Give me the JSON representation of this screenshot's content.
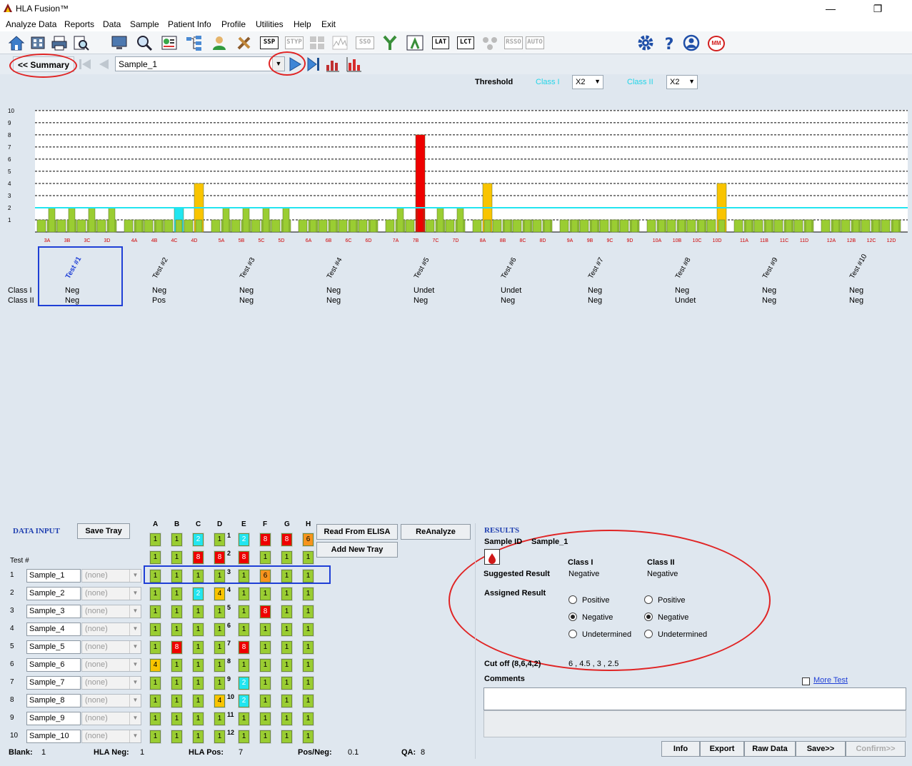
{
  "window": {
    "title": "HLA Fusion™"
  },
  "menu": [
    "Analyze Data",
    "Reports",
    "Data",
    "Sample",
    "Patient Info",
    "Profile",
    "Utilities",
    "Help",
    "Exit"
  ],
  "toolbar": {
    "text_icons": [
      "SSP",
      "STYP",
      "SSO",
      "LAT",
      "LCT",
      "RSSO",
      "AUTO"
    ],
    "right_icons": [
      "gear-icon",
      "help-icon",
      "user-icon",
      "mm-icon"
    ],
    "mm_label": "MM"
  },
  "nav": {
    "summary_label": "<< Summary",
    "sample": "Sample_1"
  },
  "threshold": {
    "label": "Threshold",
    "class1_label": "Class I",
    "class1_value": "X2",
    "class2_label": "Class II",
    "class2_value": "X2"
  },
  "chart_data": {
    "type": "bar",
    "ylim": [
      0,
      10
    ],
    "yticks": [
      1,
      2,
      3,
      4,
      5,
      6,
      7,
      8,
      9,
      10
    ],
    "threshold_line": 2,
    "categories": [
      "3A",
      "3B",
      "3C",
      "3D",
      "4A",
      "4B",
      "4C",
      "4D",
      "5A",
      "5B",
      "5C",
      "5D",
      "6A",
      "6B",
      "6C",
      "6D",
      "7A",
      "7B",
      "7C",
      "7D",
      "8A",
      "8B",
      "8C",
      "8D",
      "9A",
      "9B",
      "9C",
      "9D",
      "10A",
      "10B",
      "10C",
      "10D",
      "11A",
      "11B",
      "11C",
      "11D",
      "12A",
      "12B",
      "12C",
      "12D"
    ],
    "group_pairs": [
      [
        [
          1,
          2
        ],
        [
          1,
          2
        ],
        [
          1,
          2
        ],
        [
          1,
          2
        ]
      ],
      [
        [
          1,
          1
        ],
        [
          1,
          1
        ],
        [
          2,
          1
        ],
        [
          4,
          1
        ]
      ],
      [
        [
          1,
          2
        ],
        [
          1,
          2
        ],
        [
          1,
          2
        ],
        [
          1,
          2
        ]
      ],
      [
        [
          1,
          1
        ],
        [
          1,
          1
        ],
        [
          1,
          1
        ],
        [
          1,
          1
        ]
      ],
      [
        [
          1,
          2
        ],
        [
          8,
          2
        ],
        [
          1,
          2
        ],
        [
          1,
          2
        ]
      ],
      [
        [
          4,
          1
        ],
        [
          1,
          1
        ],
        [
          1,
          1
        ],
        [
          1,
          1
        ]
      ],
      [
        [
          1,
          1
        ],
        [
          1,
          1
        ],
        [
          1,
          1
        ],
        [
          1,
          1
        ]
      ],
      [
        [
          1,
          1
        ],
        [
          1,
          1
        ],
        [
          1,
          1
        ],
        [
          4,
          1
        ]
      ],
      [
        [
          1,
          1
        ],
        [
          1,
          1
        ],
        [
          1,
          1
        ],
        [
          1,
          1
        ]
      ],
      [
        [
          1,
          1
        ],
        [
          1,
          1
        ],
        [
          1,
          1
        ],
        [
          1,
          1
        ]
      ]
    ]
  },
  "tests": [
    {
      "name": "Test #1",
      "class1": "Neg",
      "class2": "Neg"
    },
    {
      "name": "Test #2",
      "class1": "Neg",
      "class2": "Pos"
    },
    {
      "name": "Test #3",
      "class1": "Neg",
      "class2": "Neg"
    },
    {
      "name": "Test #4",
      "class1": "Neg",
      "class2": "Neg"
    },
    {
      "name": "Test #5",
      "class1": "Undet",
      "class2": "Neg"
    },
    {
      "name": "Test #6",
      "class1": "Undet",
      "class2": "Neg"
    },
    {
      "name": "Test #7",
      "class1": "Neg",
      "class2": "Neg"
    },
    {
      "name": "Test #8",
      "class1": "Neg",
      "class2": "Undet"
    },
    {
      "name": "Test #9",
      "class1": "Neg",
      "class2": "Neg"
    },
    {
      "name": "Test #10",
      "class1": "Neg",
      "class2": "Neg"
    }
  ],
  "row_labels": {
    "class1": "Class I",
    "class2": "Class II"
  },
  "data_input": {
    "title": "DATA INPUT",
    "save_tray": "Save Tray",
    "read_elisa": "Read From ELISA",
    "reanalyze": "ReAnalyze",
    "add_tray": "Add New Tray",
    "test_hash": "Test #",
    "columns": [
      "A",
      "B",
      "C",
      "D",
      "E",
      "F",
      "G",
      "H"
    ],
    "control_rows": [
      [
        "1",
        "1",
        "2",
        "1",
        "2",
        "8",
        "8",
        "6"
      ],
      [
        "1",
        "1",
        "8",
        "8",
        "8",
        "1",
        "1",
        "1"
      ]
    ],
    "samples": [
      {
        "no": "1",
        "name": "Sample_1",
        "combo": "(none)",
        "cells": [
          "1",
          "1",
          "1",
          "1",
          "1",
          "6",
          "1",
          "1"
        ],
        "side": "3"
      },
      {
        "no": "2",
        "name": "Sample_2",
        "combo": "(none)",
        "cells": [
          "1",
          "1",
          "2",
          "4",
          "1",
          "1",
          "1",
          "1"
        ],
        "side": "4"
      },
      {
        "no": "3",
        "name": "Sample_3",
        "combo": "(none)",
        "cells": [
          "1",
          "1",
          "1",
          "1",
          "1",
          "8",
          "1",
          "1"
        ],
        "side": "5"
      },
      {
        "no": "4",
        "name": "Sample_4",
        "combo": "(none)",
        "cells": [
          "1",
          "1",
          "1",
          "1",
          "1",
          "1",
          "1",
          "1"
        ],
        "side": "6"
      },
      {
        "no": "5",
        "name": "Sample_5",
        "combo": "(none)",
        "cells": [
          "1",
          "8",
          "1",
          "1",
          "8",
          "1",
          "1",
          "1"
        ],
        "side": "7"
      },
      {
        "no": "6",
        "name": "Sample_6",
        "combo": "(none)",
        "cells": [
          "4",
          "1",
          "1",
          "1",
          "1",
          "1",
          "1",
          "1"
        ],
        "side": "8"
      },
      {
        "no": "7",
        "name": "Sample_7",
        "combo": "(none)",
        "cells": [
          "1",
          "1",
          "1",
          "1",
          "2",
          "1",
          "1",
          "1"
        ],
        "side": "9"
      },
      {
        "no": "8",
        "name": "Sample_8",
        "combo": "(none)",
        "cells": [
          "1",
          "1",
          "1",
          "4",
          "2",
          "1",
          "1",
          "1"
        ],
        "side": "10"
      },
      {
        "no": "9",
        "name": "Sample_9",
        "combo": "(none)",
        "cells": [
          "1",
          "1",
          "1",
          "1",
          "1",
          "1",
          "1",
          "1"
        ],
        "side": "11"
      },
      {
        "no": "10",
        "name": "Sample_10",
        "combo": "(none)",
        "cells": [
          "1",
          "1",
          "1",
          "1",
          "1",
          "1",
          "1",
          "1"
        ],
        "side": "12"
      }
    ],
    "control_side": [
      "1",
      "2"
    ],
    "footer": {
      "blank_label": "Blank:",
      "blank": "1",
      "hlaneg_label": "HLA Neg:",
      "hlaneg": "1",
      "hlapos_label": "HLA Pos:",
      "hlapos": "7",
      "posneg_label": "Pos/Neg:",
      "posneg": "0.1",
      "qa_label": "QA:",
      "qa": "8"
    }
  },
  "results": {
    "title": "RESULTS",
    "sample_id_label": "Sample ID",
    "sample_id": "Sample_1",
    "class1": "Class I",
    "class2": "Class II",
    "suggested_label": "Suggested Result",
    "suggested_c1": "Negative",
    "suggested_c2": "Negative",
    "assigned_label": "Assigned Result",
    "options": [
      "Positive",
      "Negative",
      "Undetermined"
    ],
    "selected_c1": "Negative",
    "selected_c2": "Negative",
    "cutoff_label": "Cut off (8,6,4,2)",
    "cutoff_value": "6 , 4.5 , 3 , 2.5",
    "comments_label": "Comments",
    "more_test": "More Test",
    "buttons": {
      "info": "Info",
      "export": "Export",
      "raw": "Raw Data",
      "save": "Save>>",
      "confirm": "Confirm>>"
    }
  },
  "colors": {
    "green": "#9acd32",
    "cyan": "#22e5f0",
    "yellow": "#f9c400",
    "red": "#ee0000",
    "orange": "#f7941d"
  }
}
